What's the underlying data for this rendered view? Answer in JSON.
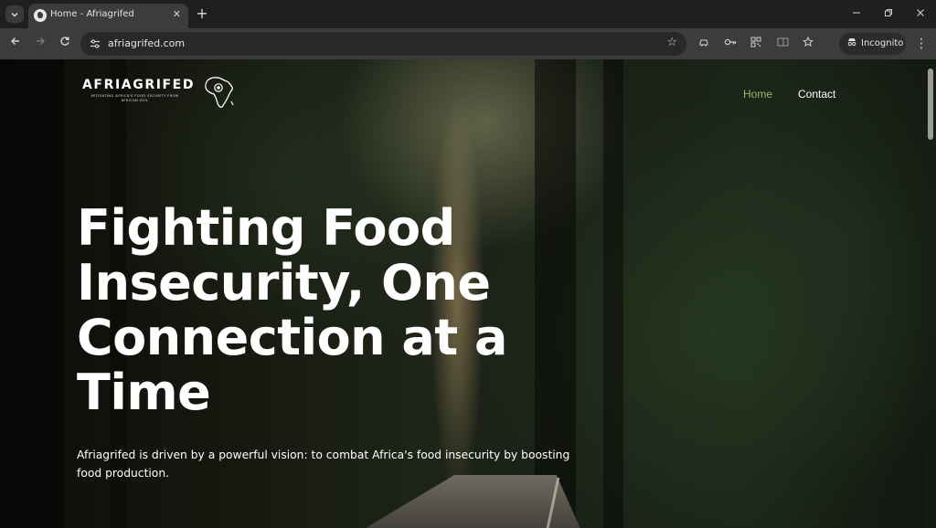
{
  "browser": {
    "tab_title": "Home - Afriagrifed",
    "url": "afriagrifed.com",
    "profile_label": "Incognito",
    "icons": {
      "tab_list": "chevron-down-icon",
      "new_tab": "plus-icon",
      "back": "arrow-left-icon",
      "forward": "arrow-right-icon",
      "reload": "reload-icon",
      "site_info": "tune-icon",
      "bookmark": "star-icon",
      "minimize": "minimize-icon",
      "restore": "restore-icon",
      "close": "close-icon",
      "menu": "more-vertical-icon"
    }
  },
  "site": {
    "brand": "AFRIAGRIFED",
    "tagline": "MITIGATING AFRICA'S FOOD SECURITY FROM AFRICAN SOIL",
    "nav": [
      {
        "label": "Home",
        "active": true
      },
      {
        "label": "Contact",
        "active": false
      }
    ],
    "hero": {
      "title": "Fighting Food Insecurity, One Connection at a Time",
      "subtitle": "Afriagrifed is driven by a powerful vision: to combat Africa's food insecurity by boosting food production."
    },
    "colors": {
      "nav_active": "#9fb46a",
      "text": "#ffffff"
    }
  }
}
